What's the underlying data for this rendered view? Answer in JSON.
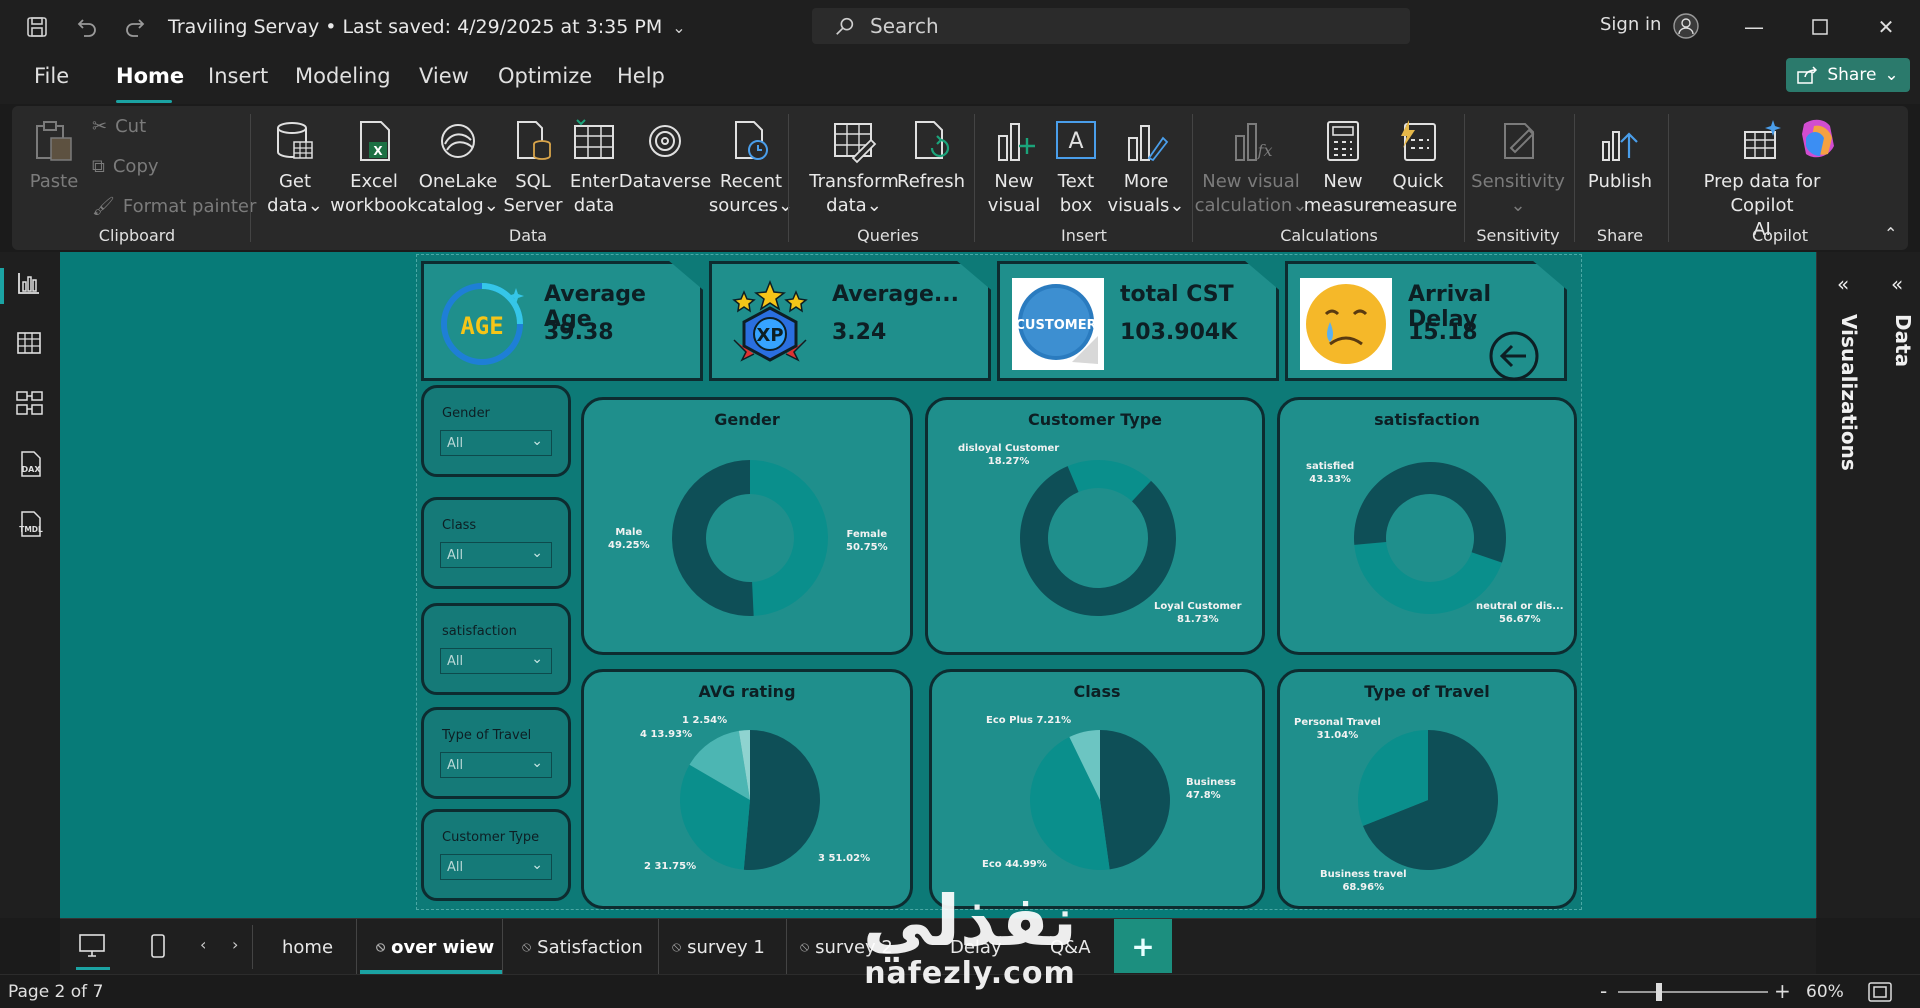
{
  "titlebar": {
    "doc_title": "Traviling Servay • Last saved: 4/29/2025 at 3:35 PM",
    "search_placeholder": "Search",
    "signin": "Sign in"
  },
  "menu": {
    "items": [
      "File",
      "Home",
      "Insert",
      "Modeling",
      "View",
      "Optimize",
      "Help"
    ],
    "active": "Home",
    "share": "Share"
  },
  "ribbon": {
    "clipboard": {
      "paste": "Paste",
      "cut": "Cut",
      "copy": "Copy",
      "format_painter": "Format painter",
      "label": "Clipboard"
    },
    "data": {
      "get_data": [
        "Get",
        "data"
      ],
      "excel": [
        "Excel",
        "workbook"
      ],
      "onelake": [
        "OneLake",
        "catalog"
      ],
      "sql": [
        "SQL",
        "Server"
      ],
      "enter": [
        "Enter",
        "data"
      ],
      "dataverse": [
        "Dataverse",
        ""
      ],
      "recent": [
        "Recent",
        "sources"
      ],
      "label": "Data"
    },
    "queries": {
      "transform": [
        "Transform",
        "data"
      ],
      "refresh": [
        "Refresh",
        ""
      ],
      "label": "Queries"
    },
    "insert": {
      "new_visual": [
        "New",
        "visual"
      ],
      "text_box": [
        "Text",
        "box"
      ],
      "more_visuals": [
        "More",
        "visuals"
      ],
      "label": "Insert"
    },
    "calculations": {
      "new_visual_calc": [
        "New visual",
        "calculation"
      ],
      "new_measure": [
        "New",
        "measure"
      ],
      "quick_measure": [
        "Quick",
        "measure"
      ],
      "label": "Calculations"
    },
    "sensitivity": {
      "button": "Sensitivity",
      "label": "Sensitivity"
    },
    "share": {
      "publish": "Publish",
      "label": "Share"
    },
    "copilot": {
      "prep": [
        "Prep data for Copilot",
        "AI"
      ],
      "label": "Copilot"
    }
  },
  "cards": [
    {
      "title": "Average Age",
      "value": "39.38",
      "icon": "age-badge-icon",
      "badge": "AGE"
    },
    {
      "title": "Average...",
      "value": "3.24",
      "icon": "xp-stars-icon",
      "badge": "XP"
    },
    {
      "title": "total CST",
      "value": "103.904K",
      "icon": "customer-sticker-icon",
      "badge": "CUSTOMER"
    },
    {
      "title": "Arrival Delay",
      "value": "15.18",
      "icon": "crying-emoji-icon",
      "badge": ""
    }
  ],
  "slicers": [
    {
      "label": "Gender",
      "value": "All"
    },
    {
      "label": "Class",
      "value": "All"
    },
    {
      "label": "satisfaction",
      "value": "All"
    },
    {
      "label": "Type of Travel",
      "value": "All"
    },
    {
      "label": "Customer Type",
      "value": "All"
    }
  ],
  "chart_data": [
    {
      "type": "pie",
      "donut": true,
      "title": "Gender",
      "labels": [
        "Male",
        "Female"
      ],
      "values": [
        49.25,
        50.75
      ],
      "display": [
        "49.25%",
        "50.75%"
      ],
      "colors": [
        "#0a8f8c",
        "#0e4f57"
      ]
    },
    {
      "type": "pie",
      "donut": true,
      "title": "Customer Type",
      "labels": [
        "disloyal Customer",
        "Loyal Customer"
      ],
      "values": [
        18.27,
        81.73
      ],
      "display": [
        "18.27%",
        "81.73%"
      ],
      "colors": [
        "#0a8f8c",
        "#0e4f57"
      ]
    },
    {
      "type": "pie",
      "donut": true,
      "title": "satisfaction",
      "labels": [
        "satisfied",
        "neutral or dis..."
      ],
      "values": [
        43.33,
        56.67
      ],
      "display": [
        "43.33%",
        "56.67%"
      ],
      "colors": [
        "#0a8f8c",
        "#0e4f57"
      ]
    },
    {
      "type": "pie",
      "donut": false,
      "title": "AVG rating",
      "labels": [
        "3",
        "2",
        "4",
        "1"
      ],
      "values": [
        51.02,
        31.75,
        13.93,
        2.54
      ],
      "display": [
        "51.02%",
        "31.75%",
        "13.93%",
        "2.54%"
      ],
      "colors": [
        "#0e4f57",
        "#0a8f8c",
        "#4cb6b3",
        "#8fd3d0"
      ]
    },
    {
      "type": "pie",
      "donut": false,
      "title": "Class",
      "labels": [
        "Business",
        "Eco",
        "Eco Plus"
      ],
      "values": [
        47.8,
        44.99,
        7.21
      ],
      "display": [
        "47.8%",
        "44.99%",
        "7.21%"
      ],
      "colors": [
        "#0e4f57",
        "#0a8f8c",
        "#6cc5c2"
      ]
    },
    {
      "type": "pie",
      "donut": false,
      "title": "Type of Travel",
      "labels": [
        "Business travel",
        "Personal Travel"
      ],
      "values": [
        68.96,
        31.04
      ],
      "display": [
        "68.96%",
        "31.04%"
      ],
      "colors": [
        "#0e4f57",
        "#0a8f8c"
      ]
    }
  ],
  "pages": {
    "tabs": [
      "home",
      "over wiew",
      "Satisfaction",
      "survey 1",
      "survey 2",
      "Delay",
      "Q&A"
    ],
    "active": "over wiew"
  },
  "status": {
    "page": "Page 2 of 7",
    "zoom": "60%"
  },
  "rightpane": {
    "visualizations": "Visualizations",
    "data": "Data"
  },
  "watermark": {
    "arabic": "نفذلي",
    "latin": "nafezly.com"
  }
}
